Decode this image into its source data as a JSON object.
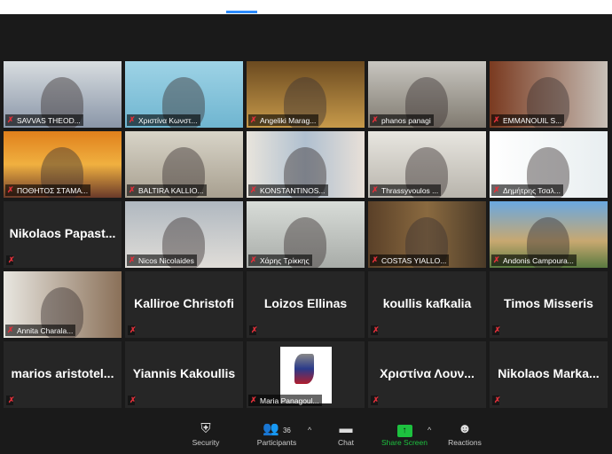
{
  "participants_count": "36",
  "colors": {
    "active_speaker": "#c8d94a",
    "share_screen": "#1dc13f",
    "muted": "#e0303a"
  },
  "tiles": [
    {
      "name": "SAVVAS THEOD...",
      "video": true,
      "bg": "linear-gradient(#d8dde0,#8a96a8)"
    },
    {
      "name": "Χριστίνα Κωνστ...",
      "video": true,
      "bg": "linear-gradient(#9ed3e6,#6fb5d0)"
    },
    {
      "name": "Angeliki Marag...",
      "video": true,
      "bg": "linear-gradient(#6b4a20,#c79a4a)"
    },
    {
      "name": "phanos panagi",
      "video": true,
      "bg": "linear-gradient(#c8c6c0,#807a70)"
    },
    {
      "name": "EMMANOUIL S...",
      "video": true,
      "bg": "linear-gradient(90deg,#7a3a20,#c8c0b8)"
    },
    {
      "name": "ΠΟΘΗΤΟΣ ΣΤΑΜΑ...",
      "video": true,
      "bg": "linear-gradient(#e0801c,#f0b040 50%,#6a3a2a)"
    },
    {
      "name": "BALTIRA KALLIO...",
      "video": true,
      "bg": "linear-gradient(#d8d4c8,#a8a090)"
    },
    {
      "name": "KONSTANTINOS...",
      "video": true,
      "bg": "linear-gradient(90deg,#e8e4dc,#b0c0d0,#e8e0d8)"
    },
    {
      "name": "Thrassyvoulos ...",
      "video": true,
      "bg": "linear-gradient(#e8e6e0,#b8b4ac)"
    },
    {
      "name": "Δημήτρης Τσαλ...",
      "video": true,
      "bg": "linear-gradient(90deg,#ffffff,#e8eef0)"
    },
    {
      "name": "Nikolaos Papast...",
      "video": false
    },
    {
      "name": "Nicos Nicolaides",
      "video": true,
      "bg": "linear-gradient(#b0b8c0,#e0ddd8)"
    },
    {
      "name": "Χάρης Τρίκκης",
      "video": true,
      "bg": "linear-gradient(#d8dcd8,#a8aca8)"
    },
    {
      "name": "COSTAS YIALLO...",
      "video": true,
      "bg": "linear-gradient(90deg,#5a4028,#8a6a40,#4a3a28)"
    },
    {
      "name": "Andonis Campoura...",
      "video": true,
      "active": true,
      "bg": "linear-gradient(#6aa8e0,#c8a870 60%,#5a7a40)"
    },
    {
      "name": "Annita Charala...",
      "video": true,
      "bg": "linear-gradient(90deg,#e8e6e0,#8a7058)"
    },
    {
      "name": "Kalliroe Christofi",
      "video": false
    },
    {
      "name": "Loizos Ellinas",
      "video": false
    },
    {
      "name": "koullis kafkalia",
      "video": false
    },
    {
      "name": "Timos Misseris",
      "video": false
    },
    {
      "name": "marios  aristotel...",
      "video": false
    },
    {
      "name": "Yiannis Kakoullis",
      "video": false
    },
    {
      "name": "Maria Panagoul...",
      "video": true,
      "logo": "ANELIXIS",
      "bg": "#262626"
    },
    {
      "name": "Χριστίνα Λουν...",
      "video": false
    },
    {
      "name": "Nikolaos  Marka...",
      "video": false
    }
  ],
  "toolbar": {
    "security": "Security",
    "participants": "Participants",
    "chat": "Chat",
    "share_screen": "Share Screen",
    "reactions": "Reactions"
  }
}
